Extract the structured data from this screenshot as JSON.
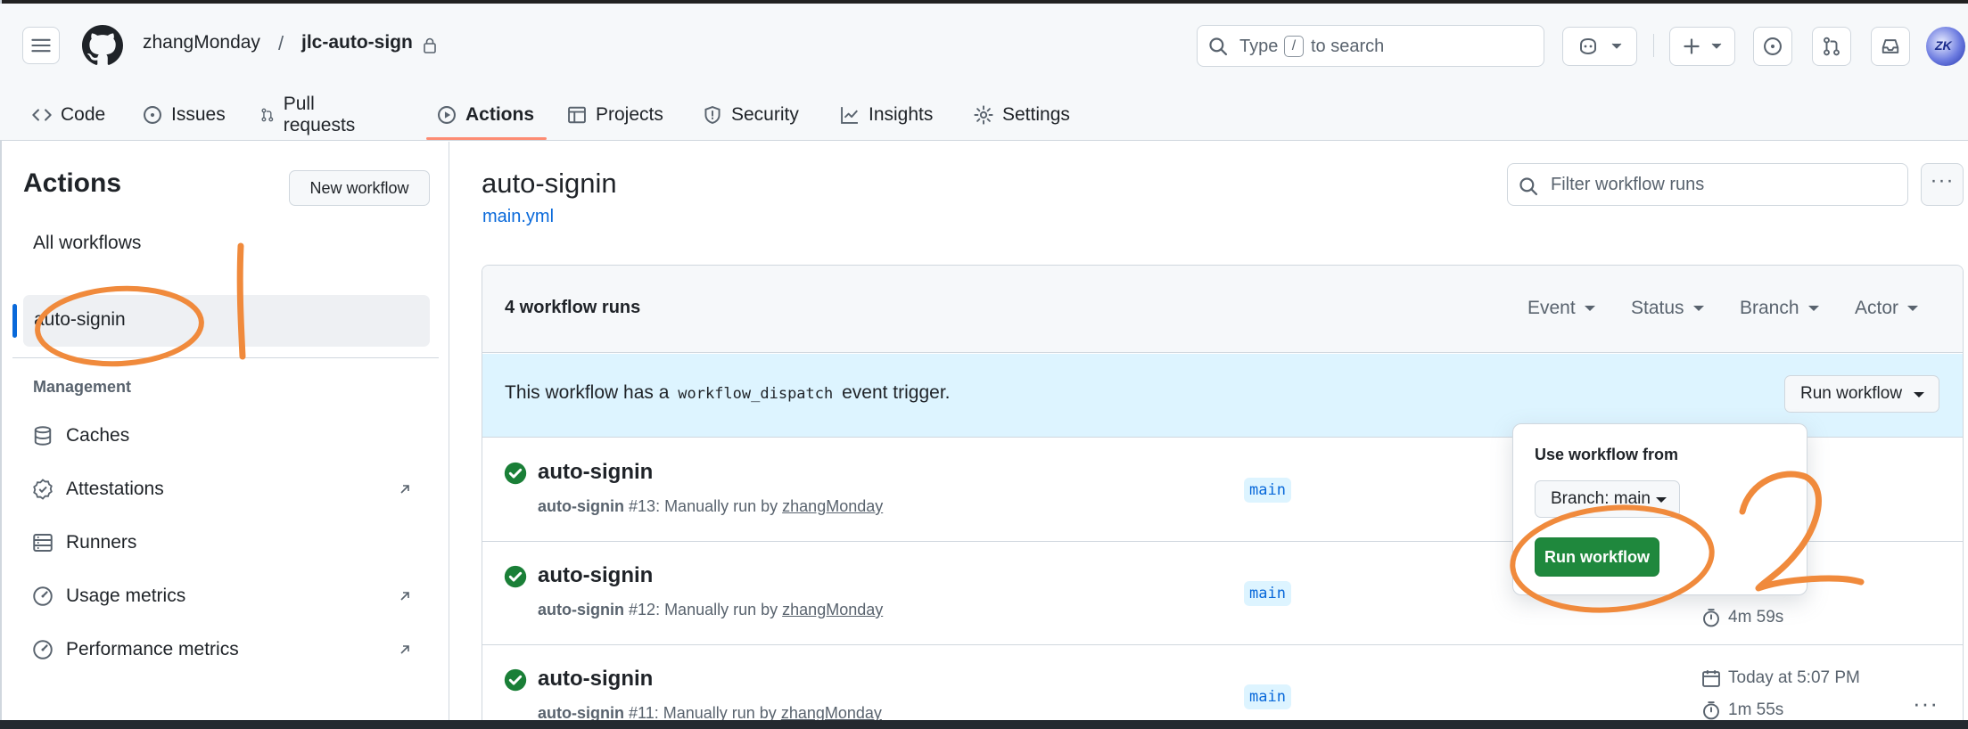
{
  "header": {
    "owner": "zhangMonday",
    "separator": "/",
    "repo": "jlc-auto-sign",
    "search_type": "Type",
    "search_key": "/",
    "search_rest": "to search",
    "avatar_text": "ZK"
  },
  "tabs": [
    {
      "label": "Code"
    },
    {
      "label": "Issues"
    },
    {
      "label": "Pull requests"
    },
    {
      "label": "Actions"
    },
    {
      "label": "Projects"
    },
    {
      "label": "Security"
    },
    {
      "label": "Insights"
    },
    {
      "label": "Settings"
    }
  ],
  "sidebar": {
    "title": "Actions",
    "new_workflow": "New workflow",
    "all_workflows": "All workflows",
    "active_workflow": "auto-signin",
    "management_label": "Management",
    "items": [
      {
        "label": "Caches"
      },
      {
        "label": "Attestations"
      },
      {
        "label": "Runners"
      },
      {
        "label": "Usage metrics"
      },
      {
        "label": "Performance metrics"
      }
    ]
  },
  "main": {
    "title": "auto-signin",
    "file": "main.yml",
    "filter_placeholder": "Filter workflow runs",
    "runs_count": "4 workflow runs",
    "filters": [
      "Event",
      "Status",
      "Branch",
      "Actor"
    ],
    "banner_pre": "This workflow has a",
    "banner_code": "workflow_dispatch",
    "banner_post": "event trigger.",
    "run_workflow_btn": "Run workflow"
  },
  "runs": [
    {
      "title": "auto-signin",
      "workflow": "auto-signin",
      "num": "#13",
      "desc": ": Manually run by",
      "actor": "zhangMonday",
      "branch": "main",
      "time": "",
      "duration": ""
    },
    {
      "title": "auto-signin",
      "workflow": "auto-signin",
      "num": "#12",
      "desc": ": Manually run by",
      "actor": "zhangMonday",
      "branch": "main",
      "time": "",
      "duration": "4m 59s"
    },
    {
      "title": "auto-signin",
      "workflow": "auto-signin",
      "num": "#11",
      "desc": ": Manually run by",
      "actor": "zhangMonday",
      "branch": "main",
      "time": "Today at 5:07 PM",
      "duration": "1m 55s"
    }
  ],
  "dropdown": {
    "title": "Use workflow from",
    "branch_btn": "Branch: main",
    "run_btn": "Run workflow"
  },
  "annotations": {
    "mark_1": "1",
    "mark_2": "2",
    "color": "#f08a3c"
  }
}
